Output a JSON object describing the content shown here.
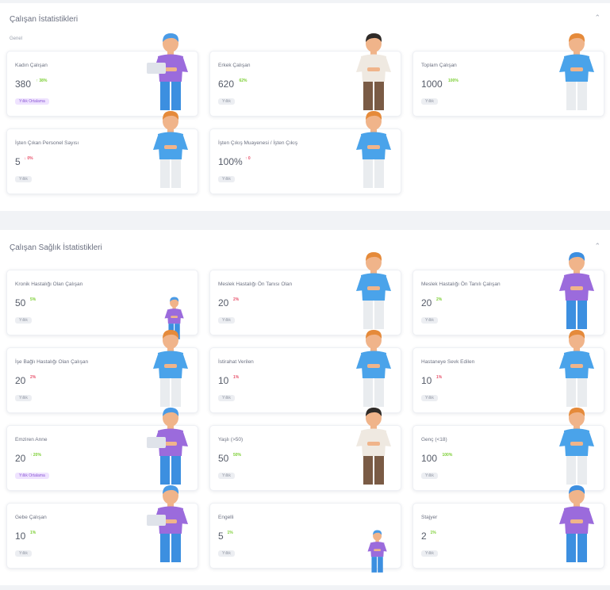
{
  "sections": [
    {
      "title": "Çalışan İstatistikleri",
      "subtitle": "Genel",
      "collapse_icon": "chevron-up-icon",
      "cards": [
        {
          "label": "Kadın Çalışan",
          "value": "380",
          "delta": "↑ 38%",
          "badge": "Yıllık Ortalama",
          "delta_color": "#7ccf34",
          "badge_style": "purple",
          "figure": "woman-blue-hair"
        },
        {
          "label": "Erkek Çalışan",
          "value": "620",
          "delta": "62%",
          "badge": "Yıllık",
          "delta_color": "#7ccf34",
          "badge_style": "gray",
          "figure": "man-beige"
        },
        {
          "label": "Toplam Çalışan",
          "value": "1000",
          "delta": "100%",
          "badge": "Yıllık",
          "delta_color": "#7ccf34",
          "badge_style": "gray",
          "figure": "man-blue"
        },
        {
          "label": "İşten Çıkan Personel Sayısı",
          "value": "5",
          "delta": "↓ 0%",
          "badge": "Yıllık",
          "delta_color": "#e8536c",
          "badge_style": "gray",
          "figure": "man-blue"
        },
        {
          "label": "İşten Çıkış Muayenesi / İşten Çıkış",
          "value": "100%",
          "delta": "↑ 0",
          "badge": "Yıllık",
          "delta_color": "#e8536c",
          "badge_style": "gray",
          "figure": "man-blue"
        }
      ]
    },
    {
      "title": "Çalışan Sağlık İstatistikleri",
      "subtitle": "",
      "collapse_icon": "chevron-up-icon",
      "cards": [
        {
          "label": "Kronik Hastalığı Olan Çalışan",
          "value": "50",
          "delta": "5%",
          "badge": "Yıllık",
          "delta_color": "#7ccf34",
          "badge_style": "gray",
          "figure": "small-purple"
        },
        {
          "label": "Meslek Hastalığı Ön Tanısı Olan",
          "value": "20",
          "delta": "2%",
          "badge": "Yıllık",
          "delta_color": "#e8536c",
          "badge_style": "gray",
          "figure": "man-blue"
        },
        {
          "label": "Meslek Hastalığı Ön Tanılı Çalışan",
          "value": "20",
          "delta": "2%",
          "badge": "Yıllık",
          "delta_color": "#7ccf34",
          "badge_style": "gray",
          "figure": "man-purple"
        },
        {
          "label": "İşe Bağlı Hastalığı Olan Çalışan",
          "value": "20",
          "delta": "2%",
          "badge": "Yıllık",
          "delta_color": "#e8536c",
          "badge_style": "gray",
          "figure": "man-blue"
        },
        {
          "label": "İstirahat Verilen",
          "value": "10",
          "delta": "1%",
          "badge": "Yıllık",
          "delta_color": "#e8536c",
          "badge_style": "gray",
          "figure": "man-blue"
        },
        {
          "label": "Hastaneye Sevk Edilen",
          "value": "10",
          "delta": "1%",
          "badge": "Yıllık",
          "delta_color": "#e8536c",
          "badge_style": "gray",
          "figure": "man-blue"
        },
        {
          "label": "Emziren Anne",
          "value": "20",
          "delta": "↑ 20%",
          "badge": "Yıllık Ortalama",
          "delta_color": "#7ccf34",
          "badge_style": "purple",
          "figure": "woman-blue-hair"
        },
        {
          "label": "Yaşlı (>50)",
          "value": "50",
          "delta": "50%",
          "badge": "Yıllık",
          "delta_color": "#7ccf34",
          "badge_style": "gray",
          "figure": "man-beige"
        },
        {
          "label": "Genç (<18)",
          "value": "100",
          "delta": "100%",
          "badge": "Yıllık",
          "delta_color": "#7ccf34",
          "badge_style": "gray",
          "figure": "man-blue"
        },
        {
          "label": "Gebe Çalışan",
          "value": "10",
          "delta": "1%",
          "badge": "Yıllık",
          "delta_color": "#7ccf34",
          "badge_style": "gray",
          "figure": "woman-blue-hair"
        },
        {
          "label": "Engelli",
          "value": "5",
          "delta": "1%",
          "badge": "Yıllık",
          "delta_color": "#7ccf34",
          "badge_style": "gray",
          "figure": "small-purple"
        },
        {
          "label": "Stajyer",
          "value": "2",
          "delta": "1%",
          "badge": "Yıllık",
          "delta_color": "#7ccf34",
          "badge_style": "gray",
          "figure": "man-purple"
        }
      ]
    }
  ]
}
